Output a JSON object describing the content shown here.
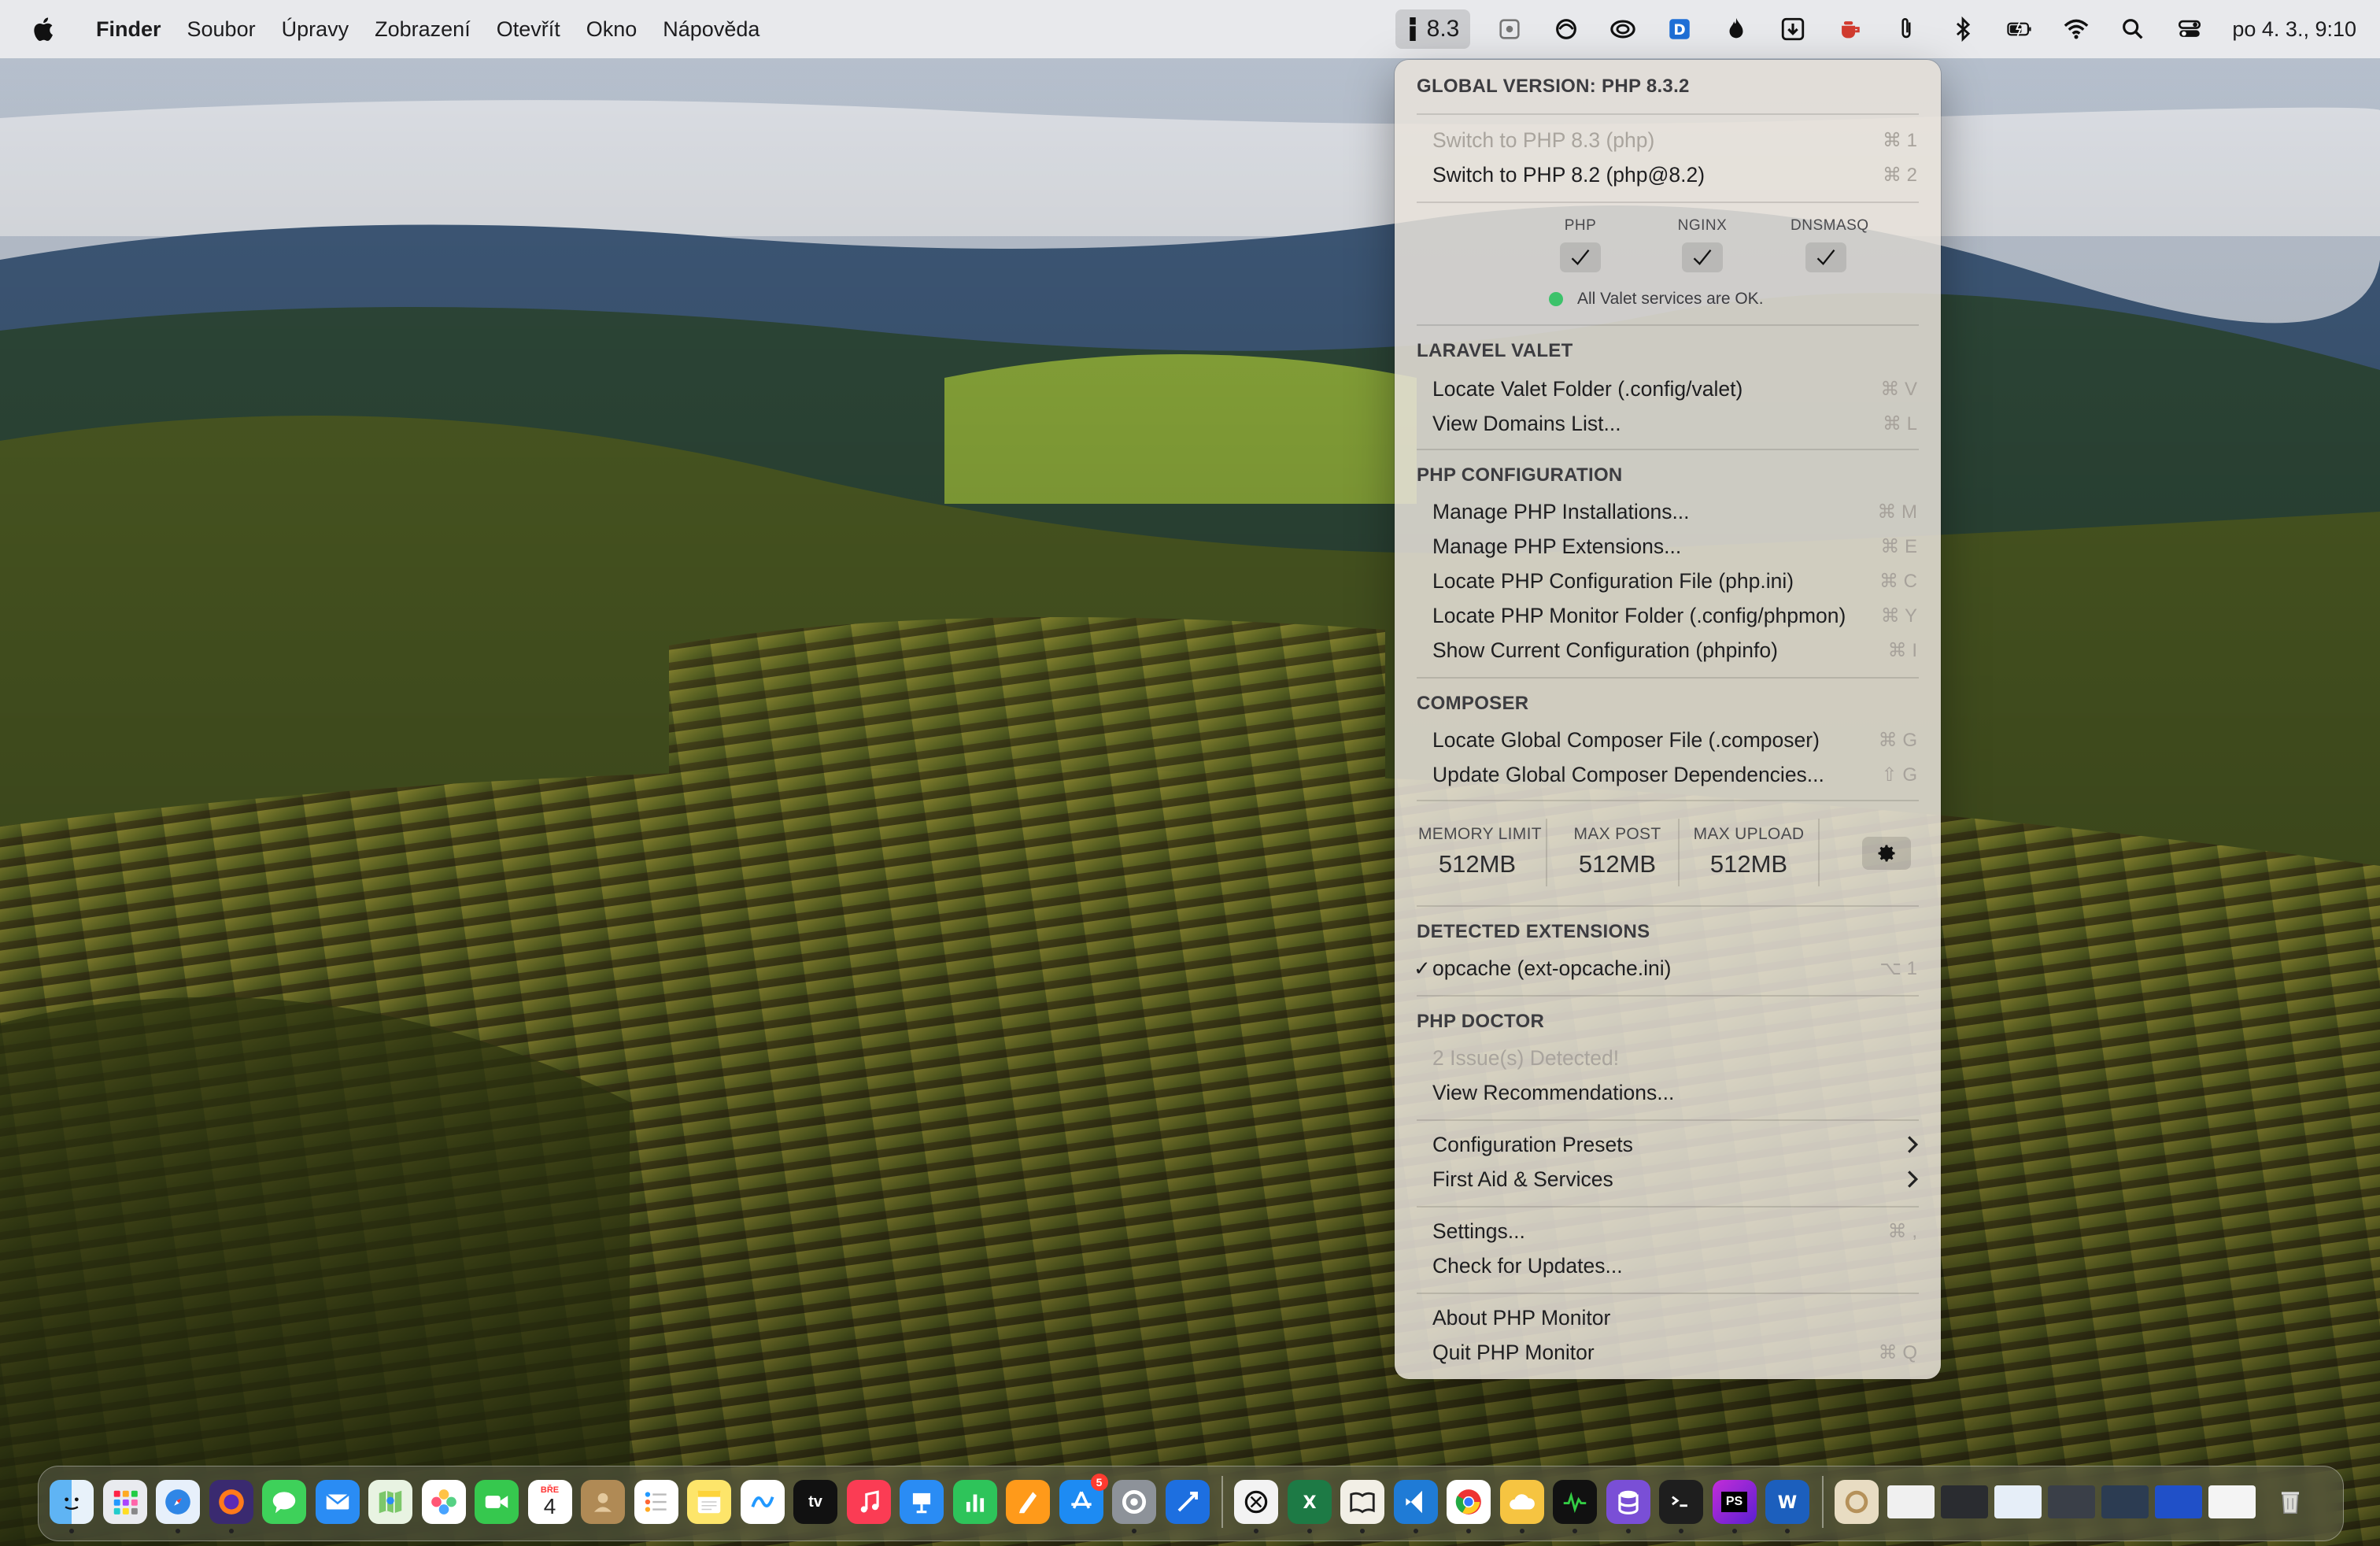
{
  "menubar": {
    "app_name": "Finder",
    "items": [
      "Soubor",
      "Úpravy",
      "Zobrazení",
      "Otevřít",
      "Okno",
      "Nápověda"
    ],
    "php_version_badge": "8.3",
    "clock": "po 4. 3., 9:10"
  },
  "menu": {
    "global_version": "GLOBAL VERSION: PHP 8.3.2",
    "switch_items": [
      {
        "label": "Switch to PHP 8.3 (php)",
        "shortcut": "⌘ 1",
        "disabled": true
      },
      {
        "label": "Switch to PHP 8.2 (php@8.2)",
        "shortcut": "⌘ 2",
        "disabled": false
      }
    ],
    "services": [
      {
        "name": "PHP",
        "ok": true
      },
      {
        "name": "NGINX",
        "ok": true
      },
      {
        "name": "DNSMASQ",
        "ok": true
      }
    ],
    "services_status": "All Valet services are OK.",
    "valet": {
      "header": "LARAVEL VALET",
      "items": [
        {
          "label": "Locate Valet Folder (.config/valet)",
          "shortcut": "⌘ V"
        },
        {
          "label": "View Domains List...",
          "shortcut": "⌘ L"
        }
      ]
    },
    "php_config": {
      "header": "PHP CONFIGURATION",
      "items": [
        {
          "label": "Manage PHP Installations...",
          "shortcut": "⌘ M"
        },
        {
          "label": "Manage PHP Extensions...",
          "shortcut": "⌘ E"
        },
        {
          "label": "Locate PHP Configuration File (php.ini)",
          "shortcut": "⌘ C"
        },
        {
          "label": "Locate PHP Monitor Folder (.config/phpmon)",
          "shortcut": "⌘ Y"
        },
        {
          "label": "Show Current Configuration (phpinfo)",
          "shortcut": "⌘ I"
        }
      ]
    },
    "composer": {
      "header": "COMPOSER",
      "items": [
        {
          "label": "Locate Global Composer File (.composer)",
          "shortcut": "⌘ G"
        },
        {
          "label": "Update Global Composer Dependencies...",
          "shortcut": "⇧ G"
        }
      ]
    },
    "limits": [
      {
        "title": "MEMORY LIMIT",
        "value": "512MB"
      },
      {
        "title": "MAX POST",
        "value": "512MB"
      },
      {
        "title": "MAX UPLOAD",
        "value": "512MB"
      }
    ],
    "extensions": {
      "header": "DETECTED EXTENSIONS",
      "items": [
        {
          "label": "opcache (ext-opcache.ini)",
          "shortcut": "⌥ 1",
          "checked": true
        }
      ]
    },
    "doctor": {
      "header": "PHP DOCTOR",
      "issues": "2 Issue(s) Detected!",
      "recommendations": "View Recommendations..."
    },
    "submenus": [
      {
        "label": "Configuration Presets"
      },
      {
        "label": "First Aid & Services"
      }
    ],
    "settings": {
      "label": "Settings...",
      "shortcut": "⌘ ,"
    },
    "updates": {
      "label": "Check for Updates..."
    },
    "about": {
      "label": "About PHP Monitor"
    },
    "quit": {
      "label": "Quit PHP Monitor",
      "shortcut": "⌘ Q"
    }
  },
  "dock": {
    "calendar_day": "4",
    "calendar_month": "BŘE",
    "appstore_badge": "5",
    "tv_label": "tv",
    "ps_label": "PS"
  },
  "colors": {
    "status_ok": "#3cc26a",
    "menubar_bg": "#ececee",
    "menu_bg": "#e8e2da"
  }
}
